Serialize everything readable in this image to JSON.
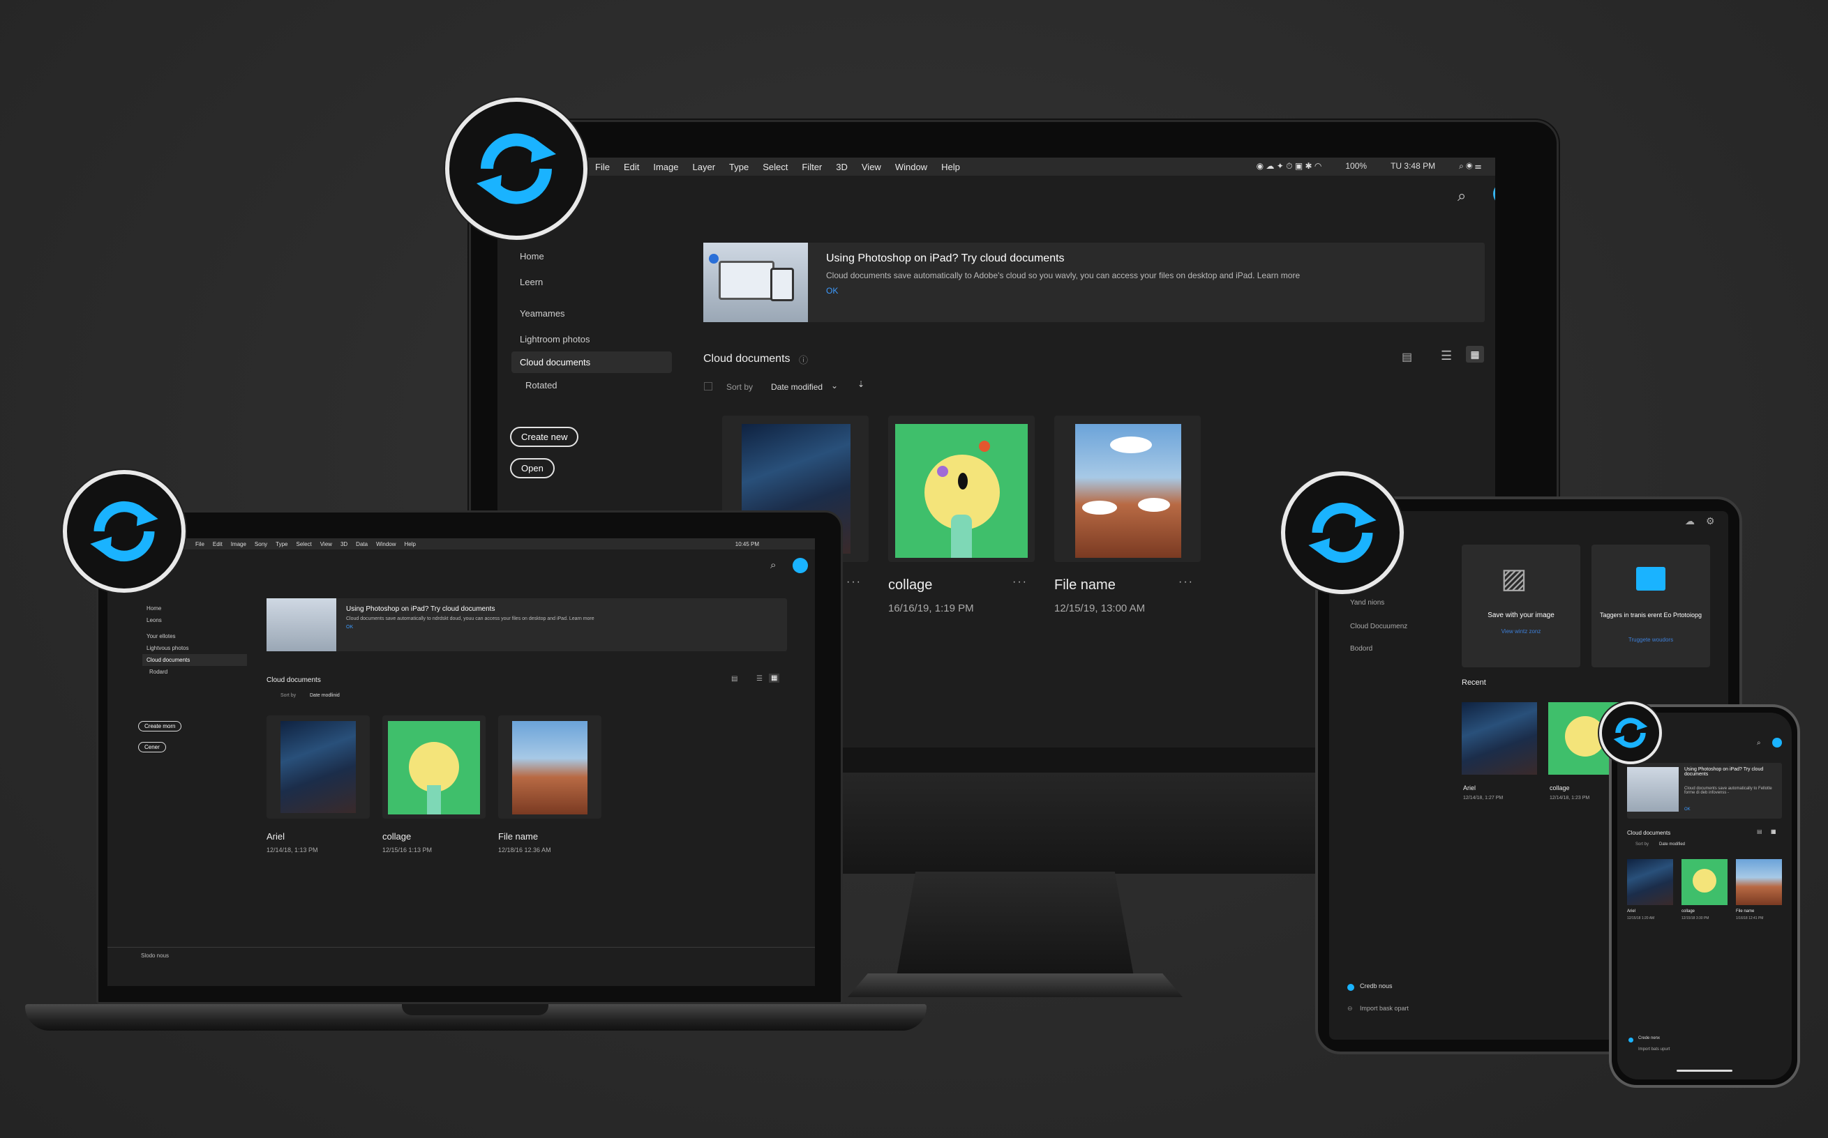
{
  "menu": [
    "File",
    "Edit",
    "Image",
    "Layer",
    "Type",
    "Select",
    "Filter",
    "3D",
    "View",
    "Window",
    "Help"
  ],
  "status": {
    "battery": "100%",
    "time": "TU 3:48 PM"
  },
  "desktop": {
    "sidebar": [
      "Home",
      "Leern",
      "Yeamames",
      "Lightroom photos",
      "Cloud documents",
      "Rotated"
    ],
    "create_new": "Create new",
    "open": "Open",
    "banner": {
      "title": "Using Photoshop on iPad? Try cloud documents",
      "body": "Cloud documents save automatically to Adobe's cloud so you wavly, you can access your files on desktop and iPad. Learn more",
      "ok": "OK"
    },
    "section": "Cloud documents",
    "sort_label": "Sort by",
    "sort_value": "Date modified",
    "files": [
      {
        "name": "",
        "date": "",
        "art": "ariel"
      },
      {
        "name": "collage",
        "date": "16/16/19, 1:19 PM",
        "art": "collage"
      },
      {
        "name": "File name",
        "date": "12/15/19, 13:00 AM",
        "art": "file"
      }
    ]
  },
  "laptop": {
    "menu": [
      "File",
      "Edit",
      "Image",
      "Sony",
      "Type",
      "Select",
      "View",
      "3D",
      "Data",
      "Window",
      "Help"
    ],
    "time": "10:45 PM",
    "sidebar": [
      "Home",
      "Leons",
      "Your ellotes",
      "Lightvous photos",
      "Cloud documents",
      "Rodard"
    ],
    "create_new": "Create morn",
    "open": "Cener",
    "banner": {
      "title": "Using Photoshop on iPad? Try cloud documents",
      "body": "Cloud documents save automatically to ndrdskt doud, youu can access your files on desktop and iPad. Learn more",
      "ok": "OK"
    },
    "section": "Cloud documents",
    "sort_label": "Sort by",
    "sort_value": "Date modlinid",
    "files": [
      {
        "name": "Ariel",
        "date": "12/14/18, 1:13 PM"
      },
      {
        "name": "collage",
        "date": "12/15/16 1:13 PM"
      },
      {
        "name": "File name",
        "date": "12/18/16 12.36 AM"
      }
    ],
    "footer": "Slodo nous"
  },
  "tablet": {
    "sidebar": [
      "Yand nions",
      "Cloud Docuumenz",
      "Bodord"
    ],
    "card1": {
      "title": "Save with your image",
      "link": "View wintz zonz"
    },
    "card2": {
      "title": "Taggers in tranis erent Eo Prtotoiopg",
      "link": "Truggete woudors"
    },
    "recent": "Recent",
    "files": [
      {
        "name": "Ariel",
        "date": "12/14/18, 1:27 PM"
      },
      {
        "name": "collage",
        "date": "12/14/18, 1:23 PM"
      }
    ],
    "bottom1": "Credb nous",
    "bottom2": "Import bask opart"
  },
  "phone": {
    "banner": {
      "title": "Using Photoshop on iPad? Try cloud documents",
      "body": "Cloud documents save automatically to Fellotte forme di deb infovenss -",
      "ok": "OK"
    },
    "section": "Cloud documents",
    "sort_label": "Sort by",
    "sort_value": "Date modified",
    "files": [
      {
        "name": "Ariel",
        "date": "12/15/18 1:20 AM"
      },
      {
        "name": "collage",
        "date": "12/15/18 3:30 PM"
      },
      {
        "name": "File name",
        "date": "1/16/18 12:41 PM"
      }
    ],
    "bottom1": "Crede nenx",
    "bottom2": "Import bats upurt"
  },
  "colors": {
    "accent": "#1ab3ff",
    "bg": "#2e2e2e",
    "panel": "#1e1e1e"
  }
}
